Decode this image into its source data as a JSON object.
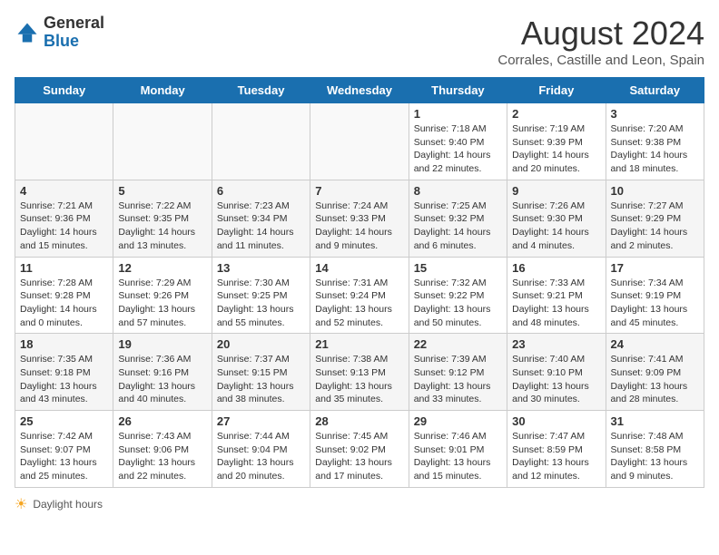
{
  "header": {
    "logo_general": "General",
    "logo_blue": "Blue",
    "month_year": "August 2024",
    "location": "Corrales, Castille and Leon, Spain"
  },
  "days_of_week": [
    "Sunday",
    "Monday",
    "Tuesday",
    "Wednesday",
    "Thursday",
    "Friday",
    "Saturday"
  ],
  "footer": {
    "daylight_label": "Daylight hours"
  },
  "weeks": [
    [
      {
        "day": "",
        "info": ""
      },
      {
        "day": "",
        "info": ""
      },
      {
        "day": "",
        "info": ""
      },
      {
        "day": "",
        "info": ""
      },
      {
        "day": "1",
        "info": "Sunrise: 7:18 AM\nSunset: 9:40 PM\nDaylight: 14 hours\nand 22 minutes."
      },
      {
        "day": "2",
        "info": "Sunrise: 7:19 AM\nSunset: 9:39 PM\nDaylight: 14 hours\nand 20 minutes."
      },
      {
        "day": "3",
        "info": "Sunrise: 7:20 AM\nSunset: 9:38 PM\nDaylight: 14 hours\nand 18 minutes."
      }
    ],
    [
      {
        "day": "4",
        "info": "Sunrise: 7:21 AM\nSunset: 9:36 PM\nDaylight: 14 hours\nand 15 minutes."
      },
      {
        "day": "5",
        "info": "Sunrise: 7:22 AM\nSunset: 9:35 PM\nDaylight: 14 hours\nand 13 minutes."
      },
      {
        "day": "6",
        "info": "Sunrise: 7:23 AM\nSunset: 9:34 PM\nDaylight: 14 hours\nand 11 minutes."
      },
      {
        "day": "7",
        "info": "Sunrise: 7:24 AM\nSunset: 9:33 PM\nDaylight: 14 hours\nand 9 minutes."
      },
      {
        "day": "8",
        "info": "Sunrise: 7:25 AM\nSunset: 9:32 PM\nDaylight: 14 hours\nand 6 minutes."
      },
      {
        "day": "9",
        "info": "Sunrise: 7:26 AM\nSunset: 9:30 PM\nDaylight: 14 hours\nand 4 minutes."
      },
      {
        "day": "10",
        "info": "Sunrise: 7:27 AM\nSunset: 9:29 PM\nDaylight: 14 hours\nand 2 minutes."
      }
    ],
    [
      {
        "day": "11",
        "info": "Sunrise: 7:28 AM\nSunset: 9:28 PM\nDaylight: 14 hours\nand 0 minutes."
      },
      {
        "day": "12",
        "info": "Sunrise: 7:29 AM\nSunset: 9:26 PM\nDaylight: 13 hours\nand 57 minutes."
      },
      {
        "day": "13",
        "info": "Sunrise: 7:30 AM\nSunset: 9:25 PM\nDaylight: 13 hours\nand 55 minutes."
      },
      {
        "day": "14",
        "info": "Sunrise: 7:31 AM\nSunset: 9:24 PM\nDaylight: 13 hours\nand 52 minutes."
      },
      {
        "day": "15",
        "info": "Sunrise: 7:32 AM\nSunset: 9:22 PM\nDaylight: 13 hours\nand 50 minutes."
      },
      {
        "day": "16",
        "info": "Sunrise: 7:33 AM\nSunset: 9:21 PM\nDaylight: 13 hours\nand 48 minutes."
      },
      {
        "day": "17",
        "info": "Sunrise: 7:34 AM\nSunset: 9:19 PM\nDaylight: 13 hours\nand 45 minutes."
      }
    ],
    [
      {
        "day": "18",
        "info": "Sunrise: 7:35 AM\nSunset: 9:18 PM\nDaylight: 13 hours\nand 43 minutes."
      },
      {
        "day": "19",
        "info": "Sunrise: 7:36 AM\nSunset: 9:16 PM\nDaylight: 13 hours\nand 40 minutes."
      },
      {
        "day": "20",
        "info": "Sunrise: 7:37 AM\nSunset: 9:15 PM\nDaylight: 13 hours\nand 38 minutes."
      },
      {
        "day": "21",
        "info": "Sunrise: 7:38 AM\nSunset: 9:13 PM\nDaylight: 13 hours\nand 35 minutes."
      },
      {
        "day": "22",
        "info": "Sunrise: 7:39 AM\nSunset: 9:12 PM\nDaylight: 13 hours\nand 33 minutes."
      },
      {
        "day": "23",
        "info": "Sunrise: 7:40 AM\nSunset: 9:10 PM\nDaylight: 13 hours\nand 30 minutes."
      },
      {
        "day": "24",
        "info": "Sunrise: 7:41 AM\nSunset: 9:09 PM\nDaylight: 13 hours\nand 28 minutes."
      }
    ],
    [
      {
        "day": "25",
        "info": "Sunrise: 7:42 AM\nSunset: 9:07 PM\nDaylight: 13 hours\nand 25 minutes."
      },
      {
        "day": "26",
        "info": "Sunrise: 7:43 AM\nSunset: 9:06 PM\nDaylight: 13 hours\nand 22 minutes."
      },
      {
        "day": "27",
        "info": "Sunrise: 7:44 AM\nSunset: 9:04 PM\nDaylight: 13 hours\nand 20 minutes."
      },
      {
        "day": "28",
        "info": "Sunrise: 7:45 AM\nSunset: 9:02 PM\nDaylight: 13 hours\nand 17 minutes."
      },
      {
        "day": "29",
        "info": "Sunrise: 7:46 AM\nSunset: 9:01 PM\nDaylight: 13 hours\nand 15 minutes."
      },
      {
        "day": "30",
        "info": "Sunrise: 7:47 AM\nSunset: 8:59 PM\nDaylight: 13 hours\nand 12 minutes."
      },
      {
        "day": "31",
        "info": "Sunrise: 7:48 AM\nSunset: 8:58 PM\nDaylight: 13 hours\nand 9 minutes."
      }
    ]
  ]
}
